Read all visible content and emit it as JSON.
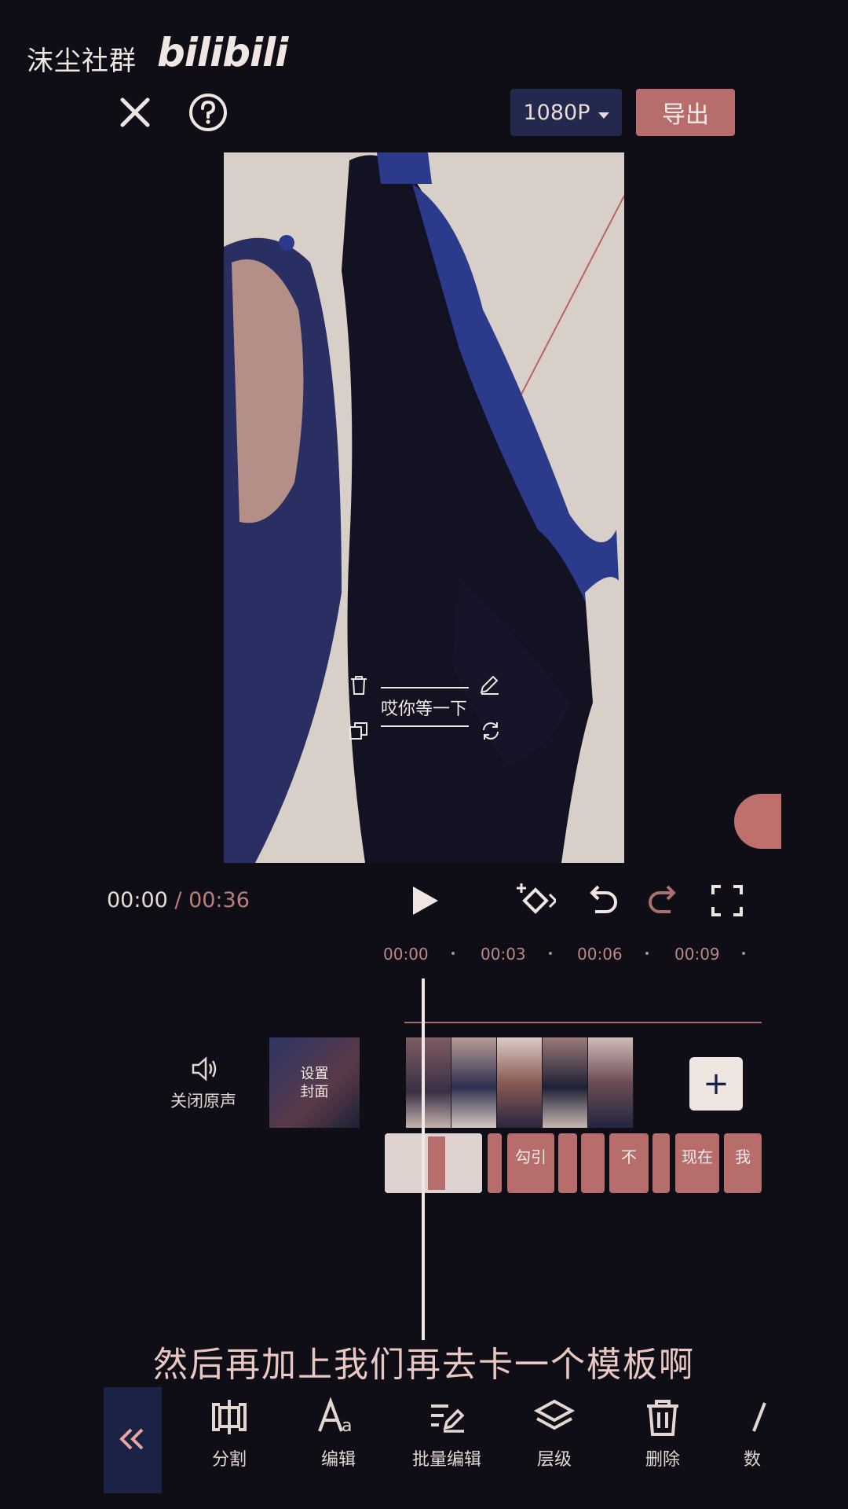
{
  "watermark": {
    "text": "沫尘社群",
    "logo": "bilibili"
  },
  "header": {
    "resolution": "1080P",
    "export_label": "导出"
  },
  "preview": {
    "overlay_text": "哎你等一下"
  },
  "transport": {
    "current_time": "00:00",
    "separator": " / ",
    "total_time": "00:36"
  },
  "ruler": {
    "ticks": [
      "00:00",
      "00:03",
      "00:06",
      "00:09"
    ]
  },
  "timeline": {
    "mute_label": "关闭原声",
    "cover_label_line1": "设置",
    "cover_label_line2": "封面",
    "add_label": "+",
    "subtitle_segments": [
      "",
      "",
      "勾引",
      "",
      "",
      "不",
      "",
      "现在",
      "我"
    ]
  },
  "caption": "然后再加上我们再去卡一个模板啊",
  "toolbar": {
    "items": [
      {
        "label": "分割",
        "icon": "split-icon"
      },
      {
        "label": "编辑",
        "icon": "text-edit-icon"
      },
      {
        "label": "批量编辑",
        "icon": "batch-edit-icon"
      },
      {
        "label": "层级",
        "icon": "layers-icon"
      },
      {
        "label": "删除",
        "icon": "trash-icon"
      },
      {
        "label": "数",
        "icon": "data-icon"
      }
    ]
  },
  "colors": {
    "accent": "#b66d6b",
    "background": "#0f0e16",
    "resolution_bg": "#23294e"
  }
}
